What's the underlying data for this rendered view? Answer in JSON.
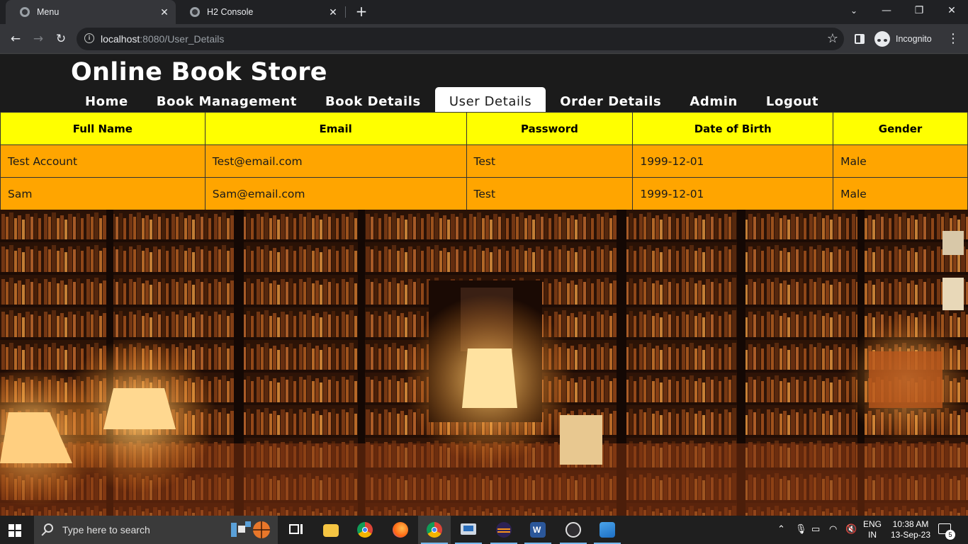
{
  "browser": {
    "tabs": [
      {
        "title": "Menu",
        "active": true
      },
      {
        "title": "H2 Console",
        "active": false
      }
    ],
    "address": {
      "host": "localhost",
      "path": ":8080/User_Details"
    },
    "profile_label": "Incognito"
  },
  "site": {
    "title": "Online Book Store",
    "menu": [
      {
        "label": "Home",
        "active": false
      },
      {
        "label": "Book Management",
        "active": false
      },
      {
        "label": "Book Details",
        "active": false
      },
      {
        "label": "User Details",
        "active": true
      },
      {
        "label": "Order Details",
        "active": false
      },
      {
        "label": "Admin",
        "active": false
      },
      {
        "label": "Logout",
        "active": false
      }
    ]
  },
  "users_table": {
    "headers": [
      "Full Name",
      "Email",
      "Password",
      "Date of Birth",
      "Gender"
    ],
    "rows": [
      [
        "Test Account",
        "Test@email.com",
        "Test",
        "1999-12-01",
        "Male"
      ],
      [
        "Sam",
        "Sam@email.com",
        "Test",
        "1999-12-01",
        "Male"
      ]
    ]
  },
  "colors": {
    "header_row": "#ffff00",
    "data_row": "#ffa500",
    "page_header": "#1b1b1b"
  },
  "taskbar": {
    "search_placeholder": "Type here to search",
    "apps": [
      "task-view-icon",
      "file-explorer-icon",
      "chrome-icon",
      "firefox-icon",
      "chrome-incognito-icon",
      "remote-desktop-icon",
      "eclipse-icon",
      "word-icon",
      "obs-icon",
      "photos-icon"
    ],
    "lang_top": "ENG",
    "lang_bottom": "IN",
    "time": "10:38 AM",
    "date": "13-Sep-23",
    "notification_count": "5"
  }
}
